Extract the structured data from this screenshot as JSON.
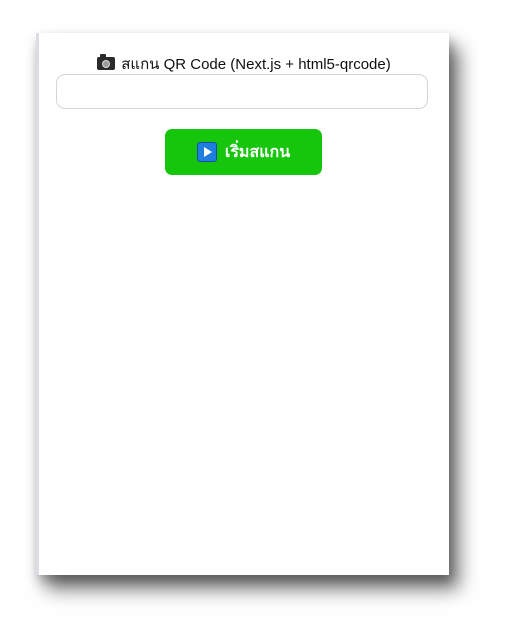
{
  "scanner": {
    "title": "สแกน QR Code (Next.js + html5-qrcode)",
    "title_icon": "camera-icon",
    "result_value": "",
    "start_button_label": "เริ่มสแกน",
    "start_button_icon": "play-icon"
  },
  "colors": {
    "button_background": "#16c60c",
    "play_icon_background": "#1e7fe0",
    "panel_background": "#ffffff"
  }
}
